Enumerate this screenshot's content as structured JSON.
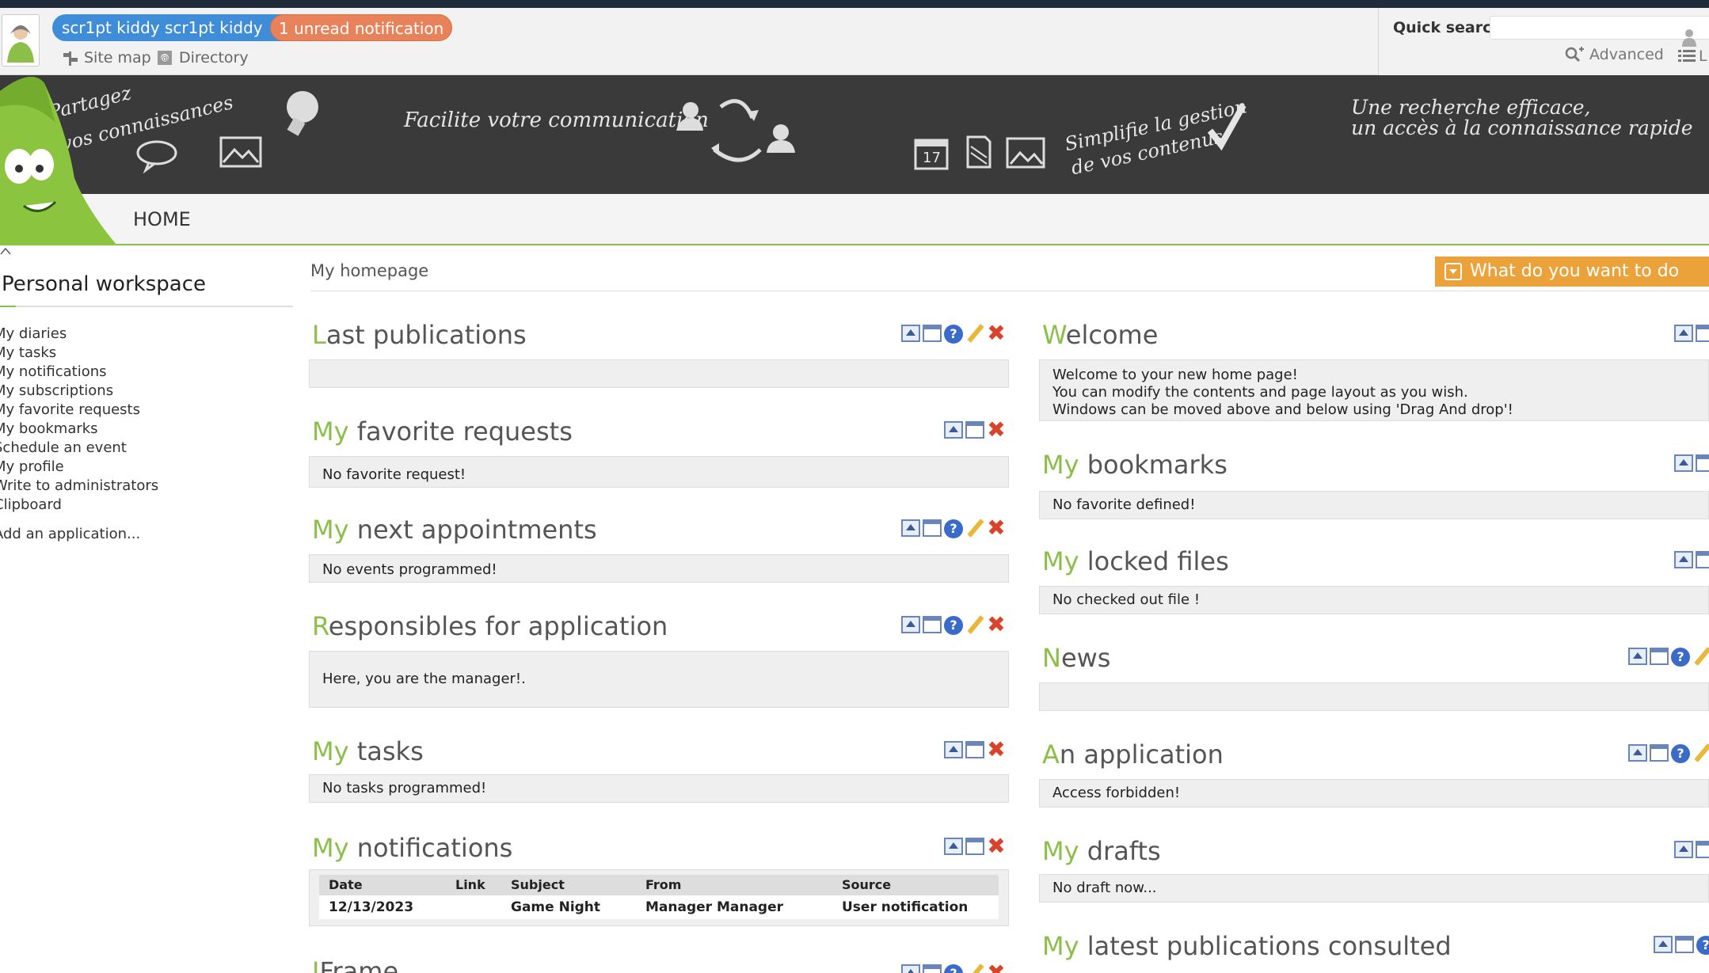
{
  "header": {
    "user_name": "scr1pt kiddy scr1pt kiddy",
    "notification_badge": "1 unread notification",
    "site_map": "Site map",
    "directory": "Directory",
    "quick_search_label": "Quick search",
    "advanced": "Advanced",
    "list_truncated": "L"
  },
  "banner": {
    "share": "Partagez\nvos connaissances",
    "share_line1": "Partagez",
    "share_line2": "vos connaissances",
    "communication": "Facilite votre communication",
    "calendar_day": "17",
    "manage_line1": "Simplifie la gestion",
    "manage_line2": "de vos contenus",
    "search_line1": "Une recherche efficace,",
    "search_line2": "un accès à la connaissance rapide"
  },
  "nav": {
    "home": "HOME"
  },
  "sidebar": {
    "title": "Personal workspace",
    "items": [
      "My diaries",
      "My tasks",
      "My notifications",
      "My subscriptions",
      "My favorite requests",
      "My bookmarks",
      "Schedule an event",
      "My profile",
      "Write to administrators",
      "Clipboard"
    ],
    "add_application": "Add an application..."
  },
  "main": {
    "breadcrumb": "My homepage",
    "next_action": "What do you want to do next?"
  },
  "left_portlets": {
    "last_publications": {
      "title_first": "L",
      "title_rest": "ast publications",
      "body": ""
    },
    "favorite_requests": {
      "title_first": "My",
      "title_rest": " favorite requests",
      "body": "No favorite request!"
    },
    "next_appointments": {
      "title_first": "My",
      "title_rest": " next appointments",
      "body": "No events programmed!"
    },
    "responsibles": {
      "title_first": "R",
      "title_rest": "esponsibles for application",
      "body": "Here, you are the manager!."
    },
    "tasks": {
      "title_first": "My",
      "title_rest": " tasks",
      "body": "No tasks programmed!"
    },
    "notifications": {
      "title_first": "My",
      "title_rest": " notifications",
      "columns": [
        "Date",
        "Link",
        "Subject",
        "From",
        "Source"
      ],
      "rows": [
        [
          "12/13/2023",
          "",
          "Game Night",
          "Manager Manager",
          "User notification"
        ]
      ]
    },
    "iframe": {
      "title_first": "I",
      "title_rest": "Frame"
    }
  },
  "right_portlets": {
    "welcome": {
      "title_first": "W",
      "title_rest": "elcome",
      "line1": "Welcome to your new home page!",
      "line2": "You can modify the contents and page layout as you wish.",
      "line3": "Windows can be moved above and below using 'Drag And drop'!"
    },
    "bookmarks": {
      "title_first": "My",
      "title_rest": " bookmarks",
      "body": "No favorite defined!"
    },
    "locked_files": {
      "title_first": "My",
      "title_rest": " locked files",
      "body": "No checked out file !"
    },
    "news": {
      "title_first": "N",
      "title_rest": "ews",
      "body": ""
    },
    "application": {
      "title_first": "A",
      "title_rest": "n application",
      "body": "Access forbidden!"
    },
    "drafts": {
      "title_first": "My",
      "title_rest": " drafts",
      "body": "No draft now..."
    },
    "latest_consulted": {
      "title_first": "My",
      "title_rest": " latest publications consulted"
    }
  },
  "colors": {
    "accent_green": "#8bbf4a",
    "user_pill": "#3f8cd9",
    "notif_pill": "#e8825a",
    "next_button": "#eca23a",
    "banner": "#3a3a3a"
  },
  "icons": [
    "user-avatar-icon",
    "gear-icon",
    "site-map-icon",
    "directory-icon",
    "person-icon",
    "search-plus-icon",
    "list-icon",
    "move-up-icon",
    "window-icon",
    "help-icon",
    "edit-icon",
    "close-icon",
    "dropdown-icon"
  ]
}
